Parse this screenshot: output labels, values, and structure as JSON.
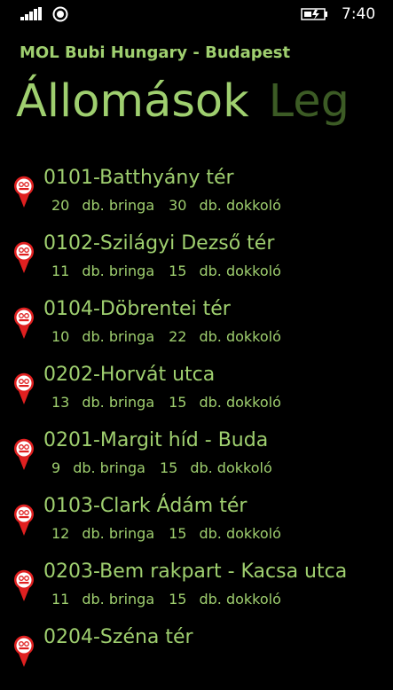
{
  "status_bar": {
    "time": "7:40"
  },
  "app": {
    "title": "MOL Bubi Hungary - Budapest"
  },
  "pivot": {
    "tabs": [
      {
        "label": "Állomások"
      },
      {
        "label": "Leg"
      }
    ]
  },
  "labels": {
    "bikes": "db. bringa",
    "docks": "db. dokkoló"
  },
  "colors": {
    "accent": "#9fcf6f",
    "inactive": "#3c5b25",
    "pin": "#e02020"
  },
  "stations": [
    {
      "name": "0101-Batthyány tér",
      "bikes": "20",
      "docks": "30"
    },
    {
      "name": "0102-Szilágyi Dezső tér",
      "bikes": "11",
      "docks": "15"
    },
    {
      "name": "0104-Döbrentei tér",
      "bikes": "10",
      "docks": "22"
    },
    {
      "name": "0202-Horvát utca",
      "bikes": "13",
      "docks": "15"
    },
    {
      "name": "0201-Margit híd -  Buda",
      "bikes": "9",
      "docks": "15"
    },
    {
      "name": "0103-Clark Ádám tér",
      "bikes": "12",
      "docks": "15"
    },
    {
      "name": "0203-Bem rakpart - Kacsa utca",
      "bikes": "11",
      "docks": "15"
    },
    {
      "name": "0204-Széna tér",
      "bikes": "",
      "docks": ""
    }
  ]
}
